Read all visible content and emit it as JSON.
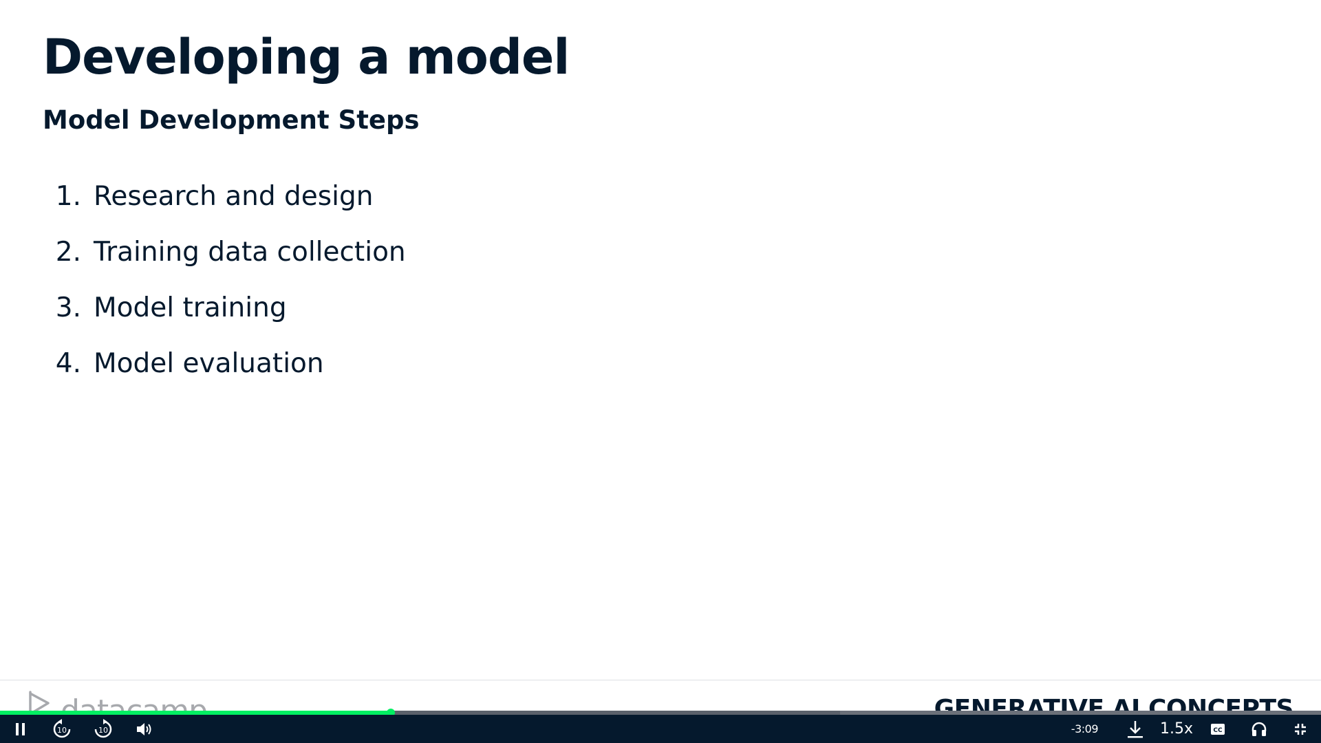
{
  "slide": {
    "title": "Developing a model",
    "subtitle": "Model Development Steps",
    "steps": [
      {
        "num": "1.",
        "label": "Research and design"
      },
      {
        "num": "2.",
        "label": "Training data collection"
      },
      {
        "num": "3.",
        "label": "Model training"
      },
      {
        "num": "4.",
        "label": "Model evaluation"
      }
    ],
    "footer": {
      "logo_text": "datacamp",
      "course_title": "GENERATIVE AI CONCEPTS"
    }
  },
  "player": {
    "progress_fraction": 0.296,
    "buffered_fraction": 0.636,
    "time_remaining": "-3:09",
    "speed": "1.5x",
    "rewind_label": "10",
    "forward_label": "10",
    "icons": [
      "pause-icon",
      "rewind-10-icon",
      "forward-10-icon",
      "volume-icon",
      "download-icon",
      "captions-icon",
      "audio-only-icon",
      "exit-fullscreen-icon"
    ]
  },
  "colors": {
    "accent": "#03ef62",
    "text": "#05192d",
    "control_bar": "#05192d"
  }
}
